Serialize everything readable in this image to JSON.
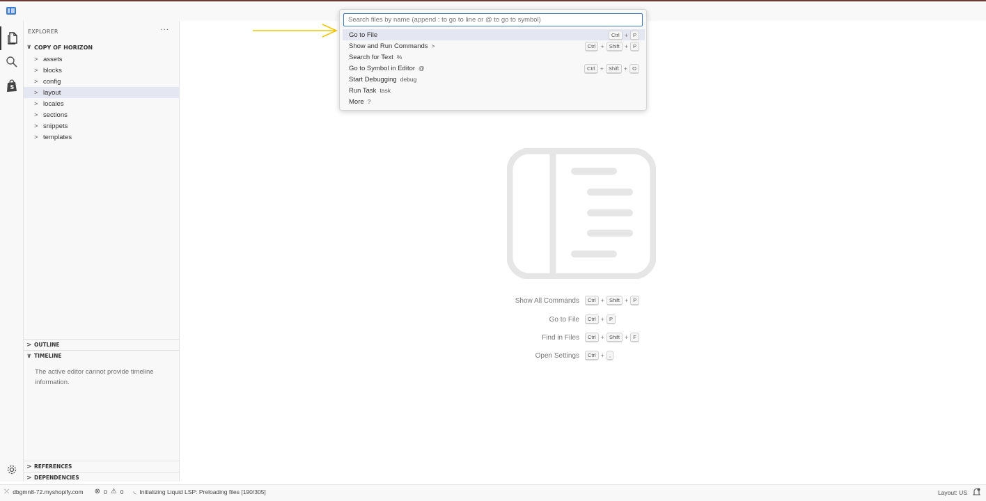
{
  "quick_pick": {
    "placeholder": "Search files by name (append : to go to line or @ to go to symbol)",
    "items": [
      {
        "label": "Go to File",
        "prefix": "",
        "keys": [
          "Ctrl",
          "P"
        ]
      },
      {
        "label": "Show and Run Commands",
        "prefix": ">",
        "keys": [
          "Ctrl",
          "Shift",
          "P"
        ]
      },
      {
        "label": "Search for Text",
        "prefix": "%",
        "keys": []
      },
      {
        "label": "Go to Symbol in Editor",
        "prefix": "@",
        "keys": [
          "Ctrl",
          "Shift",
          "O"
        ]
      },
      {
        "label": "Start Debugging",
        "prefix": "debug",
        "keys": []
      },
      {
        "label": "Run Task",
        "prefix": "task",
        "keys": []
      },
      {
        "label": "More",
        "prefix": "?",
        "keys": []
      }
    ]
  },
  "sidebar": {
    "title": "EXPLORER",
    "more": "···",
    "root": "COPY OF HORIZON",
    "folders": [
      "assets",
      "blocks",
      "config",
      "layout",
      "locales",
      "sections",
      "snippets",
      "templates"
    ],
    "selected_folder": "layout",
    "outline_label": "OUTLINE",
    "timeline_label": "TIMELINE",
    "timeline_message": "The active editor cannot provide timeline information.",
    "references_label": "REFERENCES",
    "dependencies_label": "DEPENDENCIES"
  },
  "editor_shortcuts": [
    {
      "label": "Show All Commands",
      "keys": [
        "Ctrl",
        "Shift",
        "P"
      ]
    },
    {
      "label": "Go to File",
      "keys": [
        "Ctrl",
        "P"
      ]
    },
    {
      "label": "Find in Files",
      "keys": [
        "Ctrl",
        "Shift",
        "F"
      ]
    },
    {
      "label": "Open Settings",
      "keys": [
        "Ctrl",
        ","
      ]
    }
  ],
  "statusbar": {
    "remote": "dbgmn8-72.myshopify.com",
    "errors": "0",
    "warnings": "0",
    "progress": "Initializing Liquid LSP: Preloading files [190/305]",
    "layout": "Layout: US"
  },
  "icons": {
    "app": "vscode-logo-icon",
    "explorer": "files-icon",
    "search": "search-icon",
    "shopify": "shopify-bag-icon",
    "settings": "gear-icon",
    "bell": "bell-icon"
  },
  "colors": {
    "accent": "#3b7bd6",
    "selection": "#e4e6f1",
    "arrow": "#f2c500"
  }
}
